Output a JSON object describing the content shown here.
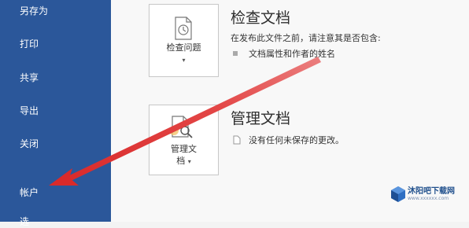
{
  "sidebar": {
    "items": [
      {
        "label": "另存为"
      },
      {
        "label": "打印"
      },
      {
        "label": "共享"
      },
      {
        "label": "导出"
      },
      {
        "label": "关闭"
      },
      {
        "label": "帐户"
      },
      {
        "label": "选"
      }
    ]
  },
  "sections": [
    {
      "button_label": "检查问题",
      "title": "检查文档",
      "description": "在发布此文件之前，请注意其是否包含:",
      "bullet": "文档属性和作者的姓名"
    },
    {
      "button_label_line1": "管理文",
      "button_label_line2": "档",
      "title": "管理文档",
      "bullet": "没有任何未保存的更改。"
    }
  ],
  "watermark": {
    "text": "沐阳吧下载网",
    "sub": "www.xxxxxx.com"
  },
  "colors": {
    "sidebar_bg": "#2b579a",
    "arrow": "#e23b3b"
  }
}
